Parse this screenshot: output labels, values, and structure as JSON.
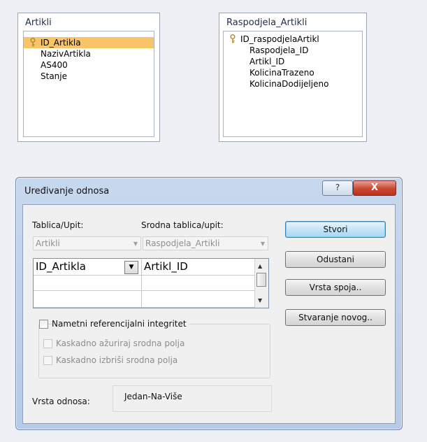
{
  "tables": [
    {
      "title": "Artikli",
      "fields": [
        "ID_Artikla",
        "NazivArtikla",
        "AS400",
        "Stanje"
      ],
      "primary_key_index": 0
    },
    {
      "title": "Raspodjela_Artikli",
      "fields": [
        "ID_raspodjelaArtikl",
        "Raspodjela_ID",
        "Artikl_ID",
        "KolicinaTrazeno",
        "KolicinaDodijeljeno"
      ],
      "primary_key_index": 0
    }
  ],
  "dialog": {
    "title": "Uređivanje odnosa",
    "help_label": "?",
    "close_label": "X",
    "table_label": "Tablica/Upit:",
    "related_table_label": "Srodna tablica/upit:",
    "table_value": "Artikli",
    "related_table_value": "Raspodjela_Artikli",
    "grid": {
      "rows": [
        {
          "left": "ID_Artikla",
          "right": "Artikl_ID"
        },
        {
          "left": "",
          "right": ""
        },
        {
          "left": "",
          "right": ""
        }
      ]
    },
    "checkboxes": {
      "enforce": "Nametni referencijalni integritet",
      "cascade_update": "Kaskadno ažuriraj srodna polja",
      "cascade_delete": "Kaskadno izbriši srodna polja"
    },
    "relation_type_label": "Vrsta odnosa:",
    "relation_type_value": "Jedan-Na-Više",
    "buttons": {
      "create": "Stvori",
      "cancel": "Odustani",
      "join_type": "Vrsta spoja..",
      "create_new": "Stvaranje novog.."
    }
  }
}
